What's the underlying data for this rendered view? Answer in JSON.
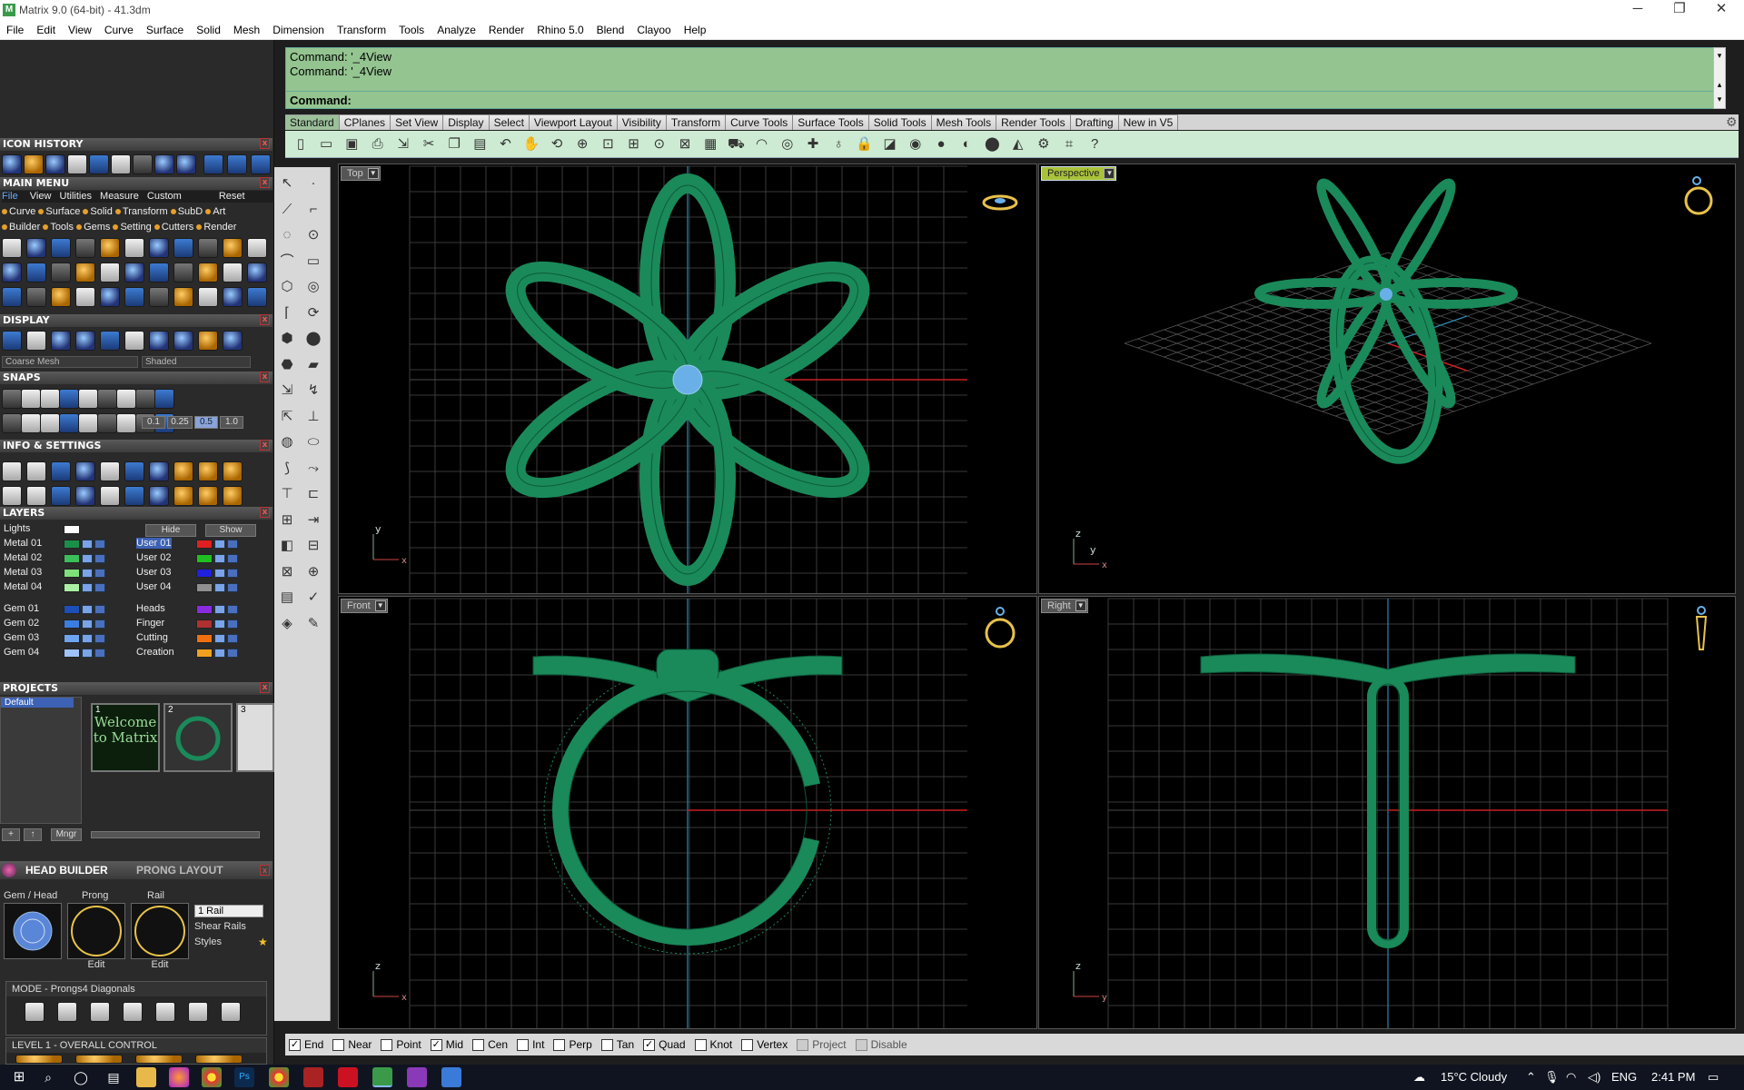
{
  "window": {
    "title": "Matrix 9.0 (64-bit) - 41.3dm",
    "minimize": "─",
    "restore": "❐",
    "close": "✕"
  },
  "menubar": [
    "File",
    "Edit",
    "View",
    "Curve",
    "Surface",
    "Solid",
    "Mesh",
    "Dimension",
    "Transform",
    "Tools",
    "Analyze",
    "Render",
    "Rhino 5.0",
    "Blend",
    "Clayoo",
    "Help"
  ],
  "command": {
    "history": [
      "Command: '_4View",
      "Command: '_4View"
    ],
    "prompt": "Command:"
  },
  "tabs": [
    "Standard",
    "CPlanes",
    "Set View",
    "Display",
    "Select",
    "Viewport Layout",
    "Visibility",
    "Transform",
    "Curve Tools",
    "Surface Tools",
    "Solid Tools",
    "Mesh Tools",
    "Render Tools",
    "Drafting",
    "New in V5"
  ],
  "left": {
    "icon_history": "ICON HISTORY",
    "main_menu": "MAIN MENU",
    "main_menu_tabs": [
      "File",
      "View",
      "Utilities",
      "Measure",
      "Custom"
    ],
    "reset": "Reset",
    "menu_row1": [
      "Curve",
      "Surface",
      "Solid",
      "Transform",
      "SubD",
      "Art"
    ],
    "menu_row2": [
      "Builder",
      "Tools",
      "Gems",
      "Setting",
      "Cutters",
      "Render"
    ],
    "display": "DISPLAY",
    "display_mesh": "Coarse Mesh",
    "display_mode": "Shaded",
    "snaps": "SNAPS",
    "snap_values": [
      "0.1",
      "0.25",
      "0.5",
      "1.0"
    ],
    "info": "INFO & SETTINGS",
    "layers": "LAYERS",
    "lights": "Lights",
    "hide": "Hide",
    "show": "Show",
    "layers_left": [
      {
        "name": "Metal 01",
        "color": "#1a8f4a"
      },
      {
        "name": "Metal 02",
        "color": "#3bbf5a"
      },
      {
        "name": "Metal 03",
        "color": "#7fe07a"
      },
      {
        "name": "Metal 04",
        "color": "#a9f0a4"
      },
      {
        "name": "Gem 01",
        "color": "#1d4fb8"
      },
      {
        "name": "Gem 02",
        "color": "#3b7de0"
      },
      {
        "name": "Gem 03",
        "color": "#6ea4f0"
      },
      {
        "name": "Gem 04",
        "color": "#9fc3f8"
      }
    ],
    "layers_right": [
      {
        "name": "User 01",
        "color": "#e02020"
      },
      {
        "name": "User 02",
        "color": "#20c020"
      },
      {
        "name": "User 03",
        "color": "#2020e0"
      },
      {
        "name": "User 04",
        "color": "#909090"
      },
      {
        "name": "Heads",
        "color": "#8a2be2"
      },
      {
        "name": "Finger",
        "color": "#b03030"
      },
      {
        "name": "Cutting",
        "color": "#f07010"
      },
      {
        "name": "Creation",
        "color": "#f0a020"
      }
    ],
    "projects": "PROJECTS",
    "project_default": "Default",
    "thumb_numbers": [
      "1",
      "2",
      "3"
    ],
    "thumb_welcome": "Welcome to Matrix",
    "mngr": "Mngr",
    "head_builder": "HEAD BUILDER",
    "prong_layout": "PRONG LAYOUT",
    "gem_head": "Gem / Head",
    "prong": "Prong",
    "rail": "Rail",
    "edit": "Edit",
    "rail_count": "1 Rail",
    "shear_rails": "Shear Rails",
    "styles": "Styles",
    "mode": "MODE - Prongs4 Diagonals",
    "level": "LEVEL 1 - OVERALL CONTROL"
  },
  "viewports": {
    "top": "Top",
    "perspective": "Perspective",
    "front": "Front",
    "right": "Right",
    "axis_y": "y",
    "axis_x": "x",
    "axis_z": "z"
  },
  "snaps_bar": [
    {
      "label": "End",
      "checked": true
    },
    {
      "label": "Near",
      "checked": false
    },
    {
      "label": "Point",
      "checked": false
    },
    {
      "label": "Mid",
      "checked": true
    },
    {
      "label": "Cen",
      "checked": false
    },
    {
      "label": "Int",
      "checked": false
    },
    {
      "label": "Perp",
      "checked": false
    },
    {
      "label": "Tan",
      "checked": false
    },
    {
      "label": "Quad",
      "checked": true
    },
    {
      "label": "Knot",
      "checked": false
    },
    {
      "label": "Vertex",
      "checked": false
    },
    {
      "label": "Project",
      "checked": false,
      "disabled": true
    },
    {
      "label": "Disable",
      "checked": false,
      "disabled": true
    }
  ],
  "taskbar": {
    "weather": "15°C  Cloudy",
    "lang": "ENG",
    "time": "2:41 PM"
  },
  "colors": {
    "model": "#1a8a5a",
    "grid": "#4a4a4a",
    "accent": "#94c490"
  }
}
